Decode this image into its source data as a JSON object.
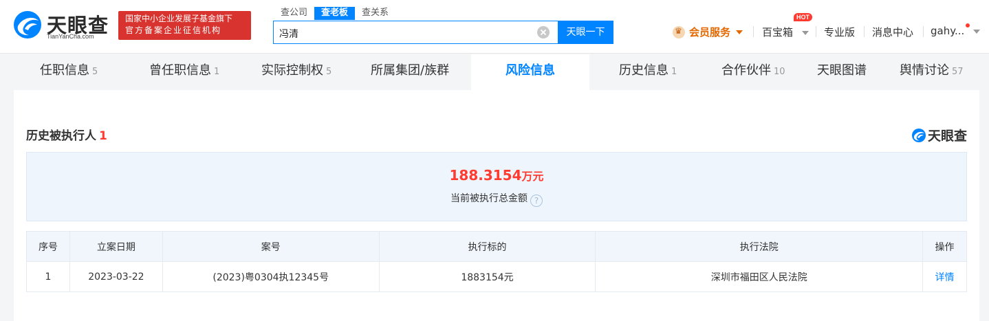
{
  "brand": {
    "name": "天眼查",
    "domain": "TianYanCha.com",
    "color": "#0084ff"
  },
  "banner": {
    "line1": "国家中小企业发展子基金旗下",
    "line2": "官方备案企业征信机构"
  },
  "search": {
    "tabs": [
      "查公司",
      "查老板",
      "查关系"
    ],
    "active_tab": "查老板",
    "value": "冯清",
    "button": "天眼一下"
  },
  "topnav": {
    "vip": "会员服务",
    "toolbox": "百宝箱",
    "toolbox_badge": "HOT",
    "pro": "专业版",
    "messages": "消息中心",
    "user": "gahy..."
  },
  "subtabs": [
    {
      "label": "任职信息",
      "count": "5"
    },
    {
      "label": "曾任职信息",
      "count": "1"
    },
    {
      "label": "实际控制权",
      "count": "5"
    },
    {
      "label": "所属集团/族群",
      "count": ""
    },
    {
      "label": "风险信息",
      "count": ""
    },
    {
      "label": "历史信息",
      "count": "1"
    },
    {
      "label": "合作伙伴",
      "count": "10"
    },
    {
      "label": "天眼图谱",
      "count": ""
    },
    {
      "label": "舆情讨论",
      "count": "57"
    }
  ],
  "section": {
    "title": "历史被执行人",
    "count": "1",
    "watermark": "天眼查"
  },
  "summary": {
    "amount": "188.3154",
    "unit": "万元",
    "label": "当前被执行总金额",
    "help": "?"
  },
  "table": {
    "headers": [
      "序号",
      "立案日期",
      "案号",
      "执行标的",
      "执行法院",
      "操作"
    ],
    "rows": [
      [
        "1",
        "2023-03-22",
        "(2023)粤0304执12345号",
        "1883154元",
        "深圳市福田区人民法院",
        "详情"
      ]
    ]
  },
  "colors": {
    "accent": "#0084ff",
    "danger": "#ff3b30",
    "vip": "#e46800",
    "banner": "#d8332e"
  }
}
